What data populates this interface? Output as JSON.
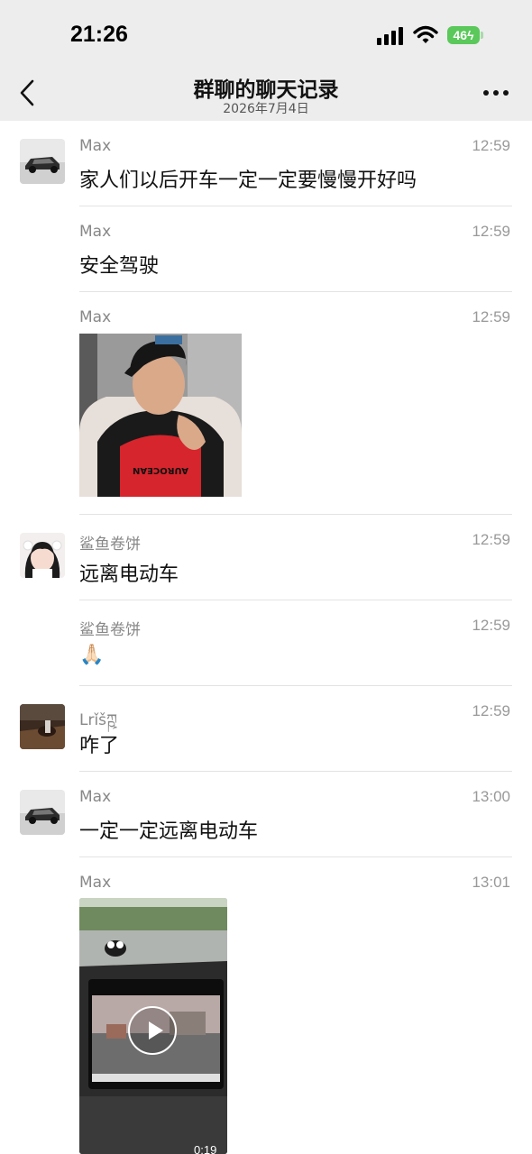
{
  "status_bar": {
    "time": "21:26",
    "battery": "46"
  },
  "header": {
    "title": "群聊的聊天记录",
    "date": "2026年7月4日"
  },
  "messages": [
    {
      "sender": "Max",
      "time": "12:59",
      "text": "家人们以后开车一定一定要慢慢开好吗"
    },
    {
      "sender": "Max",
      "time": "12:59",
      "text": "安全驾驶"
    },
    {
      "sender": "Max",
      "time": "12:59",
      "image": "photo",
      "shirt_text": "AUROCEAN"
    },
    {
      "sender": "鲨鱼卷饼",
      "time": "12:59",
      "text": "远离电动车"
    },
    {
      "sender": "鲨鱼卷饼",
      "time": "12:59",
      "text": "🙏🏻"
    },
    {
      "sender": "Lrǐš​ཀྵ",
      "time": "12:59",
      "text": "咋了"
    },
    {
      "sender": "Max",
      "time": "13:00",
      "text": "一定一定远离电动车"
    },
    {
      "sender": "Max",
      "time": "13:01",
      "video_duration": "0:19"
    }
  ],
  "colors": {
    "header_bg": "#ededed",
    "battery_green": "#5ac85a",
    "meta_gray": "#888888"
  },
  "icons": [
    "back-arrow-icon",
    "more-dots-icon",
    "cellular-signal-icon",
    "wifi-icon",
    "battery-icon",
    "play-icon"
  ]
}
